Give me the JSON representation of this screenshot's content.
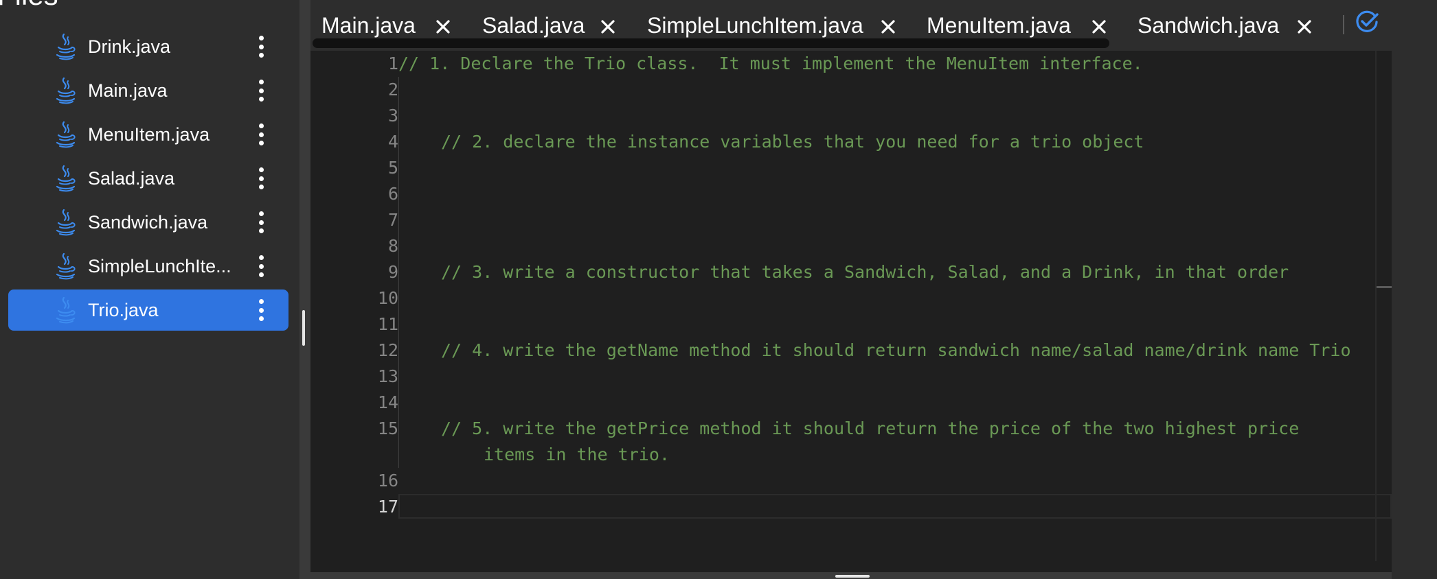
{
  "sidebar": {
    "heading": "Files",
    "files": [
      {
        "label": "Drink.java",
        "icon": "java-icon"
      },
      {
        "label": "Main.java",
        "icon": "java-icon"
      },
      {
        "label": "MenuItem.java",
        "icon": "java-icon"
      },
      {
        "label": "Salad.java",
        "icon": "java-icon"
      },
      {
        "label": "Sandwich.java",
        "icon": "java-icon"
      },
      {
        "label": "SimpleLunchIte...",
        "icon": "java-icon"
      },
      {
        "label": "Trio.java",
        "icon": "java-icon",
        "active": true
      }
    ]
  },
  "tabs": [
    {
      "label": "Main.java"
    },
    {
      "label": "Salad.java"
    },
    {
      "label": "SimpleLunchItem.java"
    },
    {
      "label": "MenuItem.java"
    },
    {
      "label": "Sandwich.java"
    }
  ],
  "toolbar": {
    "check_icon": "check-circle-icon"
  },
  "editor": {
    "current_line": 17,
    "lines": [
      {
        "num": "1",
        "text": "// 1. Declare the Trio class.  It must implement the MenuItem interface."
      },
      {
        "num": "2",
        "text": ""
      },
      {
        "num": "3",
        "text": ""
      },
      {
        "num": "4",
        "text": "// 2. declare the instance variables that you need for a trio object"
      },
      {
        "num": "5",
        "text": ""
      },
      {
        "num": "6",
        "text": ""
      },
      {
        "num": "7",
        "text": ""
      },
      {
        "num": "8",
        "text": ""
      },
      {
        "num": "9",
        "text": "// 3. write a constructor that takes a Sandwich, Salad, and a Drink, in that order"
      },
      {
        "num": "10",
        "text": ""
      },
      {
        "num": "11",
        "text": ""
      },
      {
        "num": "12",
        "text": "// 4. write the getName method it should return sandwich name/salad name/drink name Trio"
      },
      {
        "num": "13",
        "text": ""
      },
      {
        "num": "14",
        "text": ""
      },
      {
        "num": "15",
        "text": "// 5. write the getPrice method it should return the price of the two highest price",
        "wrap": "items in the trio."
      },
      {
        "num": "16",
        "text": ""
      },
      {
        "num": "17",
        "text": ""
      }
    ]
  },
  "colors": {
    "accent": "#2f74e0",
    "comment": "#6a9955",
    "line_number": "#858585",
    "sidebar_bg": "#2d2d2d",
    "editor_bg": "#1f1f1f"
  }
}
